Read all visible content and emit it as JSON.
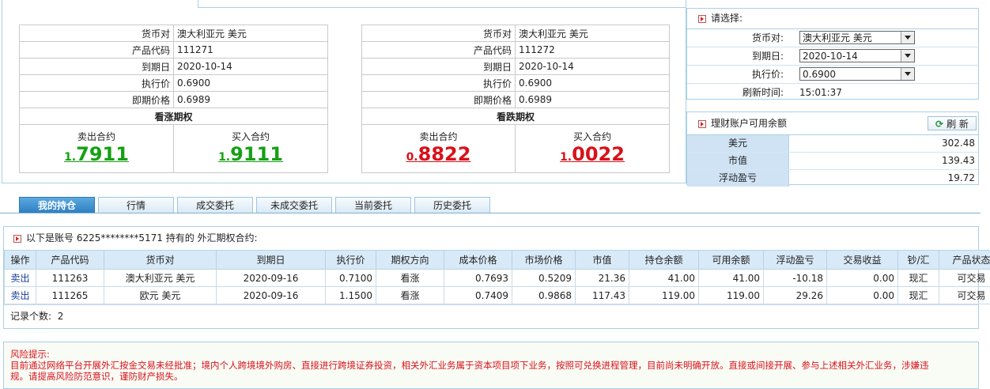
{
  "call_quote": {
    "rows": [
      {
        "label": "货币对",
        "value": "澳大利亚元 美元"
      },
      {
        "label": "产品代码",
        "value": "111271"
      },
      {
        "label": "到期日",
        "value": "2020-10-14"
      },
      {
        "label": "执行价",
        "value": "0.6900"
      },
      {
        "label": "即期价格",
        "value": "0.6989"
      }
    ],
    "title": "看涨期权",
    "sell_label": "卖出合约",
    "sell_prefix": "1.",
    "sell_main": "7911",
    "buy_label": "买入合约",
    "buy_prefix": "1.",
    "buy_main": "9111",
    "color": "#15a015"
  },
  "put_quote": {
    "rows": [
      {
        "label": "货币对",
        "value": "澳大利亚元 美元"
      },
      {
        "label": "产品代码",
        "value": "111272"
      },
      {
        "label": "到期日",
        "value": "2020-10-14"
      },
      {
        "label": "执行价",
        "value": "0.6900"
      },
      {
        "label": "即期价格",
        "value": "0.6989"
      }
    ],
    "title": "看跌期权",
    "sell_label": "卖出合约",
    "sell_prefix": "0.",
    "sell_main": "8822",
    "buy_label": "买入合约",
    "buy_prefix": "1.",
    "buy_main": "0022",
    "color": "#d8111a"
  },
  "selector": {
    "title": "请选择:",
    "currency_label": "货币对:",
    "currency_value": "澳大利亚元 美元",
    "expiry_label": "到期日:",
    "expiry_value": "2020-10-14",
    "strike_label": "执行价:",
    "strike_value": "0.6900",
    "refresh_time_label": "刷新时间:",
    "refresh_time_value": "15:01:37"
  },
  "balance": {
    "title": "理财账户可用余额",
    "refresh_label": "刷 新",
    "rows": [
      {
        "label": "美元",
        "value": "302.48"
      },
      {
        "label": "市值",
        "value": "139.43"
      },
      {
        "label": "浮动盈亏",
        "value": "19.72"
      }
    ]
  },
  "tabs": [
    "我的持仓",
    "行情",
    "成交委托",
    "未成交委托",
    "当前委托",
    "历史委托"
  ],
  "holdings": {
    "info": "以下是账号 6225********5171 持有的 外汇期权合约:",
    "columns": [
      "操作",
      "产品代码",
      "货币对",
      "到期日",
      "执行价",
      "期权方向",
      "成本价格",
      "市场价格",
      "市值",
      "持仓余额",
      "可用余额",
      "浮动盈亏",
      "交易收益",
      "钞/汇",
      "产品状态"
    ],
    "rows": [
      [
        "卖出",
        "111263",
        "澳大利亚元 美元",
        "2020-09-16",
        "0.7100",
        "看涨",
        "0.7693",
        "0.5209",
        "21.36",
        "41.00",
        "41.00",
        "-10.18",
        "0.00",
        "现汇",
        "可交易"
      ],
      [
        "卖出",
        "111265",
        "欧元 美元",
        "2020-09-16",
        "1.1500",
        "看涨",
        "0.7409",
        "0.9868",
        "117.43",
        "119.00",
        "119.00",
        "29.26",
        "0.00",
        "现汇",
        "可交易"
      ]
    ],
    "record_label": "记录个数:",
    "record_count": "2"
  },
  "risk": {
    "title": "风险提示:",
    "line1": "目前通过网络平台开展外汇按金交易未经批准；境内个人跨境境外购房、直接进行跨境证券投资，相关外汇业务属于资本项目项下业务，按照可兑换进程管理，目前尚未明确开放。直接或间接开展、参与上述相关外汇业务，涉嫌违",
    "line2": "规。请提高风险防范意识，谨防财产损失。"
  },
  "colors": {
    "accent": "#2f7fc2",
    "border": "#a8d0e6",
    "green": "#15a015",
    "red": "#d8111a"
  }
}
